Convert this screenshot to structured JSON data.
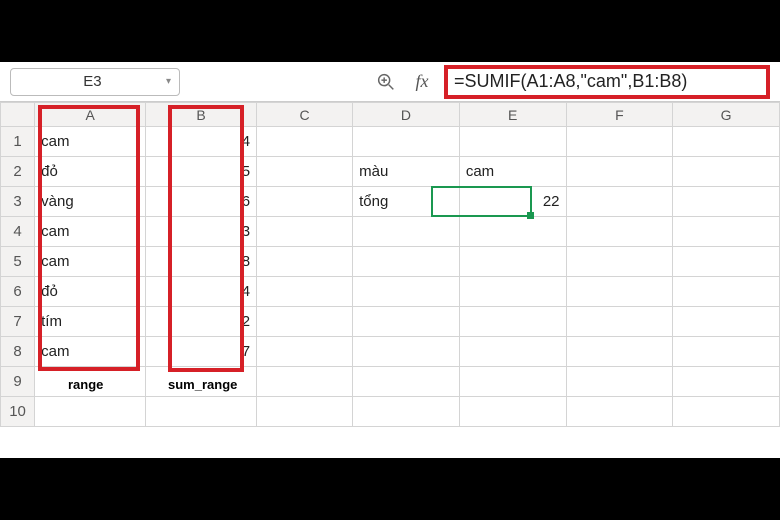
{
  "toolbar": {
    "cell_reference": "E3",
    "formula": "=SUMIF(A1:A8,\"cam\",B1:B8)"
  },
  "columns": [
    "A",
    "B",
    "C",
    "D",
    "E",
    "F",
    "G"
  ],
  "rows": [
    "1",
    "2",
    "3",
    "4",
    "5",
    "6",
    "7",
    "8",
    "9",
    "10"
  ],
  "cells": {
    "A1": "cam",
    "B1": "4",
    "A2": "đỏ",
    "B2": "5",
    "A3": "vàng",
    "B3": "6",
    "A4": "cam",
    "B4": "3",
    "A5": "cam",
    "B5": "8",
    "A6": "đỏ",
    "B6": "4",
    "A7": "tím",
    "B7": "2",
    "A8": "cam",
    "B8": "7",
    "D2": "màu",
    "E2": "cam",
    "D3": "tổng",
    "E3": "22"
  },
  "annotations": {
    "range_label": "range",
    "sum_range_label": "sum_range"
  },
  "chart_data": {
    "type": "table",
    "title": "SUMIF example",
    "formula": "=SUMIF(A1:A8,\"cam\",B1:B8)",
    "range_column": [
      "cam",
      "đỏ",
      "vàng",
      "cam",
      "cam",
      "đỏ",
      "tím",
      "cam"
    ],
    "sum_range_column": [
      4,
      5,
      6,
      3,
      8,
      4,
      2,
      7
    ],
    "criteria": "cam",
    "result": 22
  }
}
